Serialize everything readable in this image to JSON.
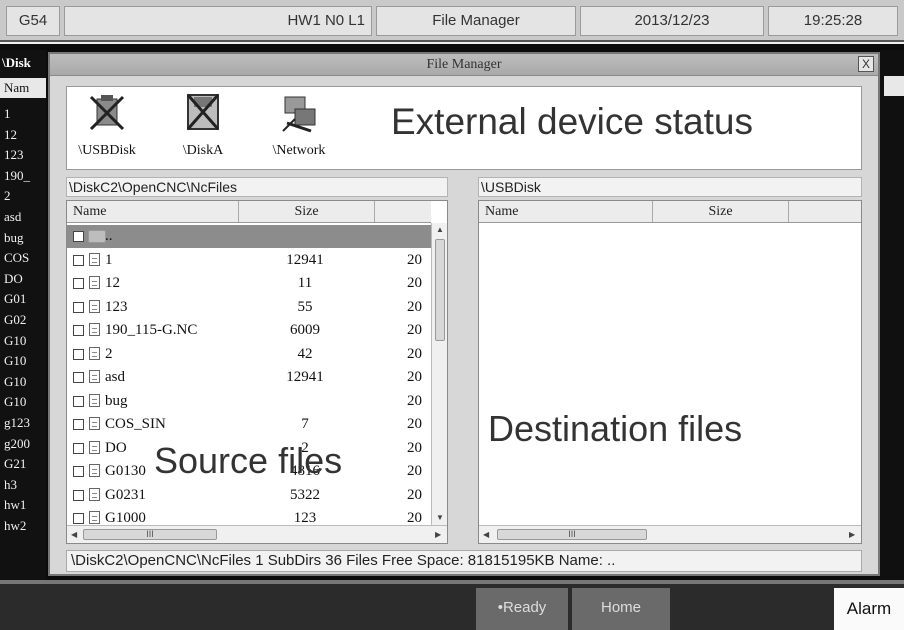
{
  "topbar": {
    "mode": "G54",
    "info": "HW1 N0 L1",
    "title": "File Manager",
    "date": "2013/12/23",
    "time": "19:25:28"
  },
  "background_app": {
    "path": "\\Disk",
    "header": "Nam",
    "items": [
      "1",
      "12",
      "123",
      "190_",
      "2",
      "asd",
      "bug",
      "COS",
      "DO",
      "G01",
      "G02",
      "G10",
      "G10",
      "G10",
      "G10",
      "g123",
      "g200",
      "G21",
      "h3",
      "hw1",
      "hw2"
    ]
  },
  "dialog": {
    "title": "File Manager",
    "close_label": "X",
    "devices": [
      {
        "label": "\\USBDisk",
        "icon": "usb-disk-icon"
      },
      {
        "label": "\\DiskA",
        "icon": "disk-a-icon"
      },
      {
        "label": "\\Network",
        "icon": "network-icon"
      }
    ],
    "source": {
      "path": "\\DiskC2\\OpenCNC\\NcFiles",
      "columns": [
        "Name",
        "Size",
        ""
      ],
      "rows": [
        {
          "name": "..",
          "size": "",
          "date": "",
          "type": "folder"
        },
        {
          "name": "1",
          "size": "12941",
          "date": "20",
          "type": "file"
        },
        {
          "name": "12",
          "size": "11",
          "date": "20",
          "type": "file"
        },
        {
          "name": "123",
          "size": "55",
          "date": "20",
          "type": "file"
        },
        {
          "name": "190_115-G.NC",
          "size": "6009",
          "date": "20",
          "type": "file"
        },
        {
          "name": "2",
          "size": "42",
          "date": "20",
          "type": "file"
        },
        {
          "name": "asd",
          "size": "12941",
          "date": "20",
          "type": "file"
        },
        {
          "name": "bug",
          "size": "",
          "date": "20",
          "type": "file"
        },
        {
          "name": "COS_SIN",
          "size": "7",
          "date": "20",
          "type": "file"
        },
        {
          "name": "DO",
          "size": "2",
          "date": "20",
          "type": "file"
        },
        {
          "name": "G0130",
          "size": "4816",
          "date": "20",
          "type": "file"
        },
        {
          "name": "G0231",
          "size": "5322",
          "date": "20",
          "type": "file"
        },
        {
          "name": "G1000",
          "size": "123",
          "date": "20",
          "type": "file"
        }
      ],
      "scroll_glyph": "III"
    },
    "destination": {
      "path": "\\USBDisk",
      "columns": [
        "Name",
        "Size",
        ""
      ],
      "scroll_glyph": "III"
    },
    "status": "\\DiskC2\\OpenCNC\\NcFiles 1 SubDirs 36 Files Free Space: 81815195KB  Name: .."
  },
  "annotations": {
    "devices": "External device status",
    "source": "Source files",
    "destination": "Destination files"
  },
  "bottom": {
    "ready": "•Ready",
    "home": "Home",
    "alarm": "Alarm"
  }
}
